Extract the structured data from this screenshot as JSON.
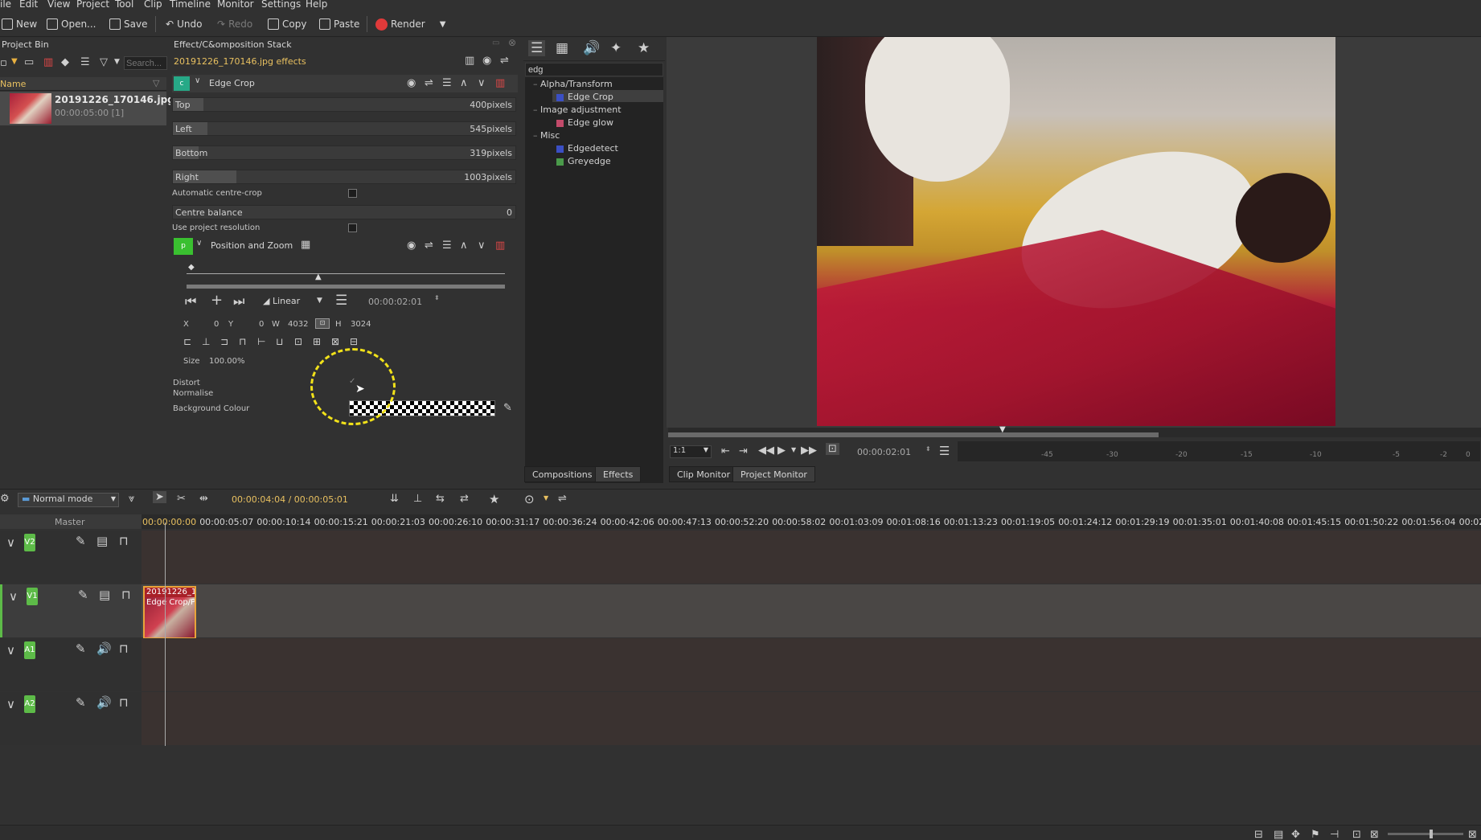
{
  "menu": [
    "ile",
    "Edit",
    "View",
    "Project",
    "Tool",
    "Clip",
    "Timeline",
    "Monitor",
    "Settings",
    "Help"
  ],
  "toolbar": {
    "new": "New",
    "open": "Open...",
    "save": "Save",
    "undo": "Undo",
    "redo": "Redo",
    "copy": "Copy",
    "paste": "Paste",
    "render": "Render"
  },
  "bin": {
    "title": "Project Bin",
    "search_placeholder": "Search...",
    "column": "Name",
    "clip_name": "20191226_170146.jpg",
    "clip_meta": "00:00:05:00 [1]"
  },
  "stack": {
    "title": "Effect/C&omposition Stack",
    "subtitle": "20191226_170146.jpg effects",
    "edge_crop": {
      "badge": "c",
      "name": "Edge Crop",
      "top_label": "Top",
      "top_value": "400pixels",
      "top_frac": 0.09,
      "left_label": "Left",
      "left_value": "545pixels",
      "left_frac": 0.1,
      "bottom_label": "Bottom",
      "bottom_value": "319pixels",
      "bottom_frac": 0.075,
      "right_label": "Right",
      "right_value": "1003pixels",
      "right_frac": 0.185,
      "auto_centre": "Automatic centre-crop",
      "centre_balance": "Centre balance",
      "centre_balance_value": "0",
      "project_res": "Use project resolution"
    },
    "pos_zoom": {
      "badge": "p",
      "name": "Position and Zoom",
      "interp": "Linear",
      "timecode": "00:00:02:01",
      "x_label": "X",
      "x": "0",
      "y_label": "Y",
      "y": "0",
      "w_label": "W",
      "w": "4032",
      "h_label": "H",
      "h": "3024",
      "size_label": "Size",
      "size": "100.00%",
      "distort": "Distort",
      "normalise": "Normalise",
      "bg_colour": "Background Colour"
    }
  },
  "effects": {
    "search": "edg",
    "groups": [
      {
        "name": "Alpha/Transform",
        "items": [
          {
            "name": "Edge Crop",
            "color": "#3b4fc4"
          }
        ]
      },
      {
        "name": "Image adjustment",
        "items": [
          {
            "name": "Edge glow",
            "color": "#c24a6a"
          }
        ]
      },
      {
        "name": "Misc",
        "items": [
          {
            "name": "Edgedetect",
            "color": "#3b4fc4"
          },
          {
            "name": "Greyedge",
            "color": "#4a9a4a"
          }
        ]
      }
    ],
    "tab_compositions": "Compositions",
    "tab_effects": "Effects"
  },
  "monitor": {
    "zoom": "1:1",
    "timecode": "00:00:02:01",
    "tab_clip": "Clip Monitor",
    "tab_project": "Project Monitor",
    "audio_scale": [
      "-45",
      "-30",
      "-20",
      "-15",
      "-10",
      "-5",
      "-2",
      "0"
    ]
  },
  "timeline": {
    "mode": "Normal mode",
    "timecode": "00:00:04:04 / 00:00:05:01",
    "master": "Master",
    "ruler": [
      "00:00:00:00",
      "00:00:05:07",
      "00:00:10:14",
      "00:00:15:21",
      "00:00:21:03",
      "00:00:26:10",
      "00:00:31:17",
      "00:00:36:24",
      "00:00:42:06",
      "00:00:47:13",
      "00:00:52:20",
      "00:00:58:02",
      "00:01:03:09",
      "00:01:08:16",
      "00:01:13:23",
      "00:01:19:05",
      "00:01:24:12",
      "00:01:29:19",
      "00:01:35:01",
      "00:01:40:08",
      "00:01:45:15",
      "00:01:50:22",
      "00:01:56:04",
      "00:02"
    ],
    "tracks": [
      "V2",
      "V1",
      "A1",
      "A2"
    ],
    "clip_title": "20191226_1",
    "clip_sub": "Edge Crop/P"
  },
  "colors": {
    "accent": "#f0c040",
    "track_badge": "#5dbb48",
    "clip_border": "#e8a43a"
  }
}
